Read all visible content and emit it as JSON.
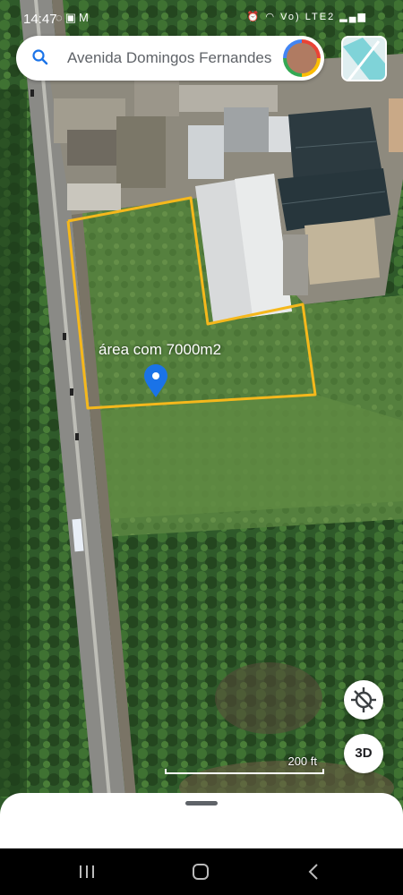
{
  "status_bar": {
    "time": "14:47",
    "left_icons": [
      "whatsapp-icon",
      "image-icon",
      "mail-icon"
    ],
    "right_icons": [
      "alarm-icon",
      "wifi-icon",
      "signal-icon"
    ],
    "network_label": "Vo) LTE2"
  },
  "search": {
    "text": "Avenida Domingos Fernandes"
  },
  "map": {
    "type": "satellite",
    "annotation": "área com 7000m2",
    "polygon_color": "#f5b81c",
    "pin_color": "#1a73e8"
  },
  "controls": {
    "three_d_label": "3D",
    "scale_label": "200 ft"
  },
  "colors": {
    "accent": "#1a73e8",
    "sheet": "#ffffff",
    "navbar": "#000000"
  }
}
